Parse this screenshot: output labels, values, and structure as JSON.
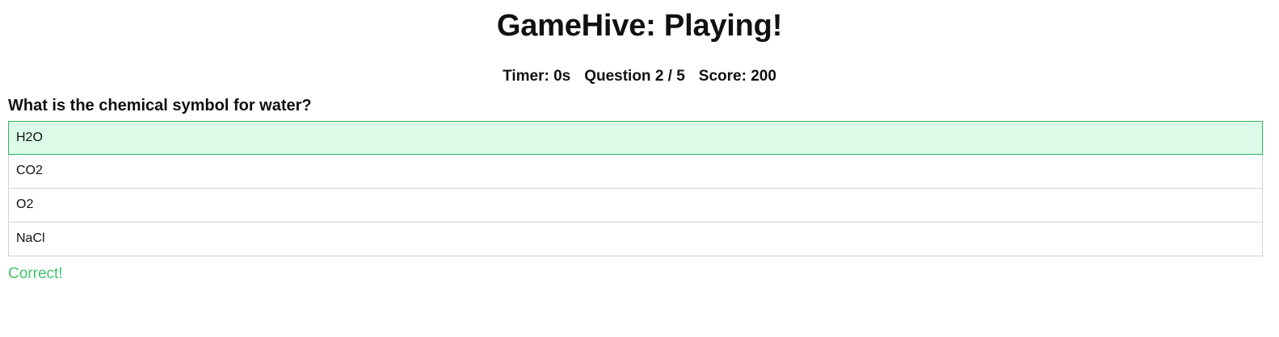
{
  "title": "GameHive: Playing!",
  "stats": {
    "timer": "Timer: 0s",
    "question": "Question 2 / 5",
    "score": "Score: 200"
  },
  "question": "What is the chemical symbol for water?",
  "answers": [
    {
      "label": "H2O",
      "state": "correct"
    },
    {
      "label": "CO2",
      "state": "default"
    },
    {
      "label": "O2",
      "state": "default"
    },
    {
      "label": "NaCl",
      "state": "default"
    }
  ],
  "feedback": "Correct!",
  "colors": {
    "correct_background": "#dcfbe8",
    "correct_border": "#2fb65f",
    "feedback_text": "#41c26a"
  }
}
